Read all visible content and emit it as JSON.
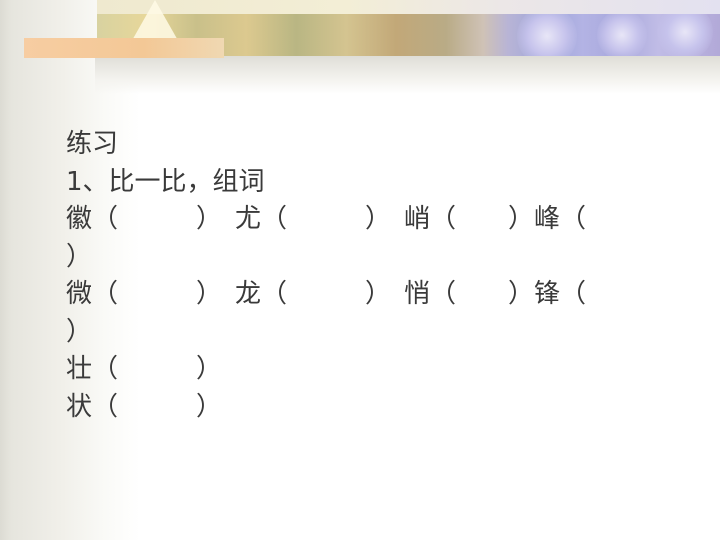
{
  "lines": [
    "练习",
    "1、比一比，组词",
    "徽（　　　）　尤（　　　）　峭（　　）峰（",
    "）",
    "微（　　　）　龙（　　　）　悄（　　）锋（",
    "）",
    "壮（　　　）",
    "状（　　　）"
  ]
}
